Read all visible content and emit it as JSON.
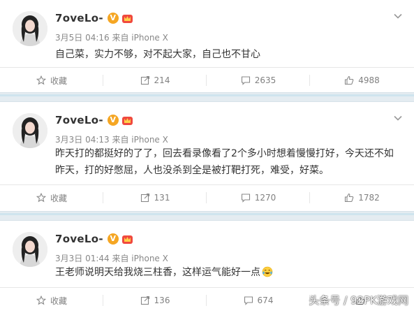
{
  "posts": [
    {
      "username": "7oveLo-",
      "meta": "3月5日 04:16 来自 iPhone X",
      "text": "自己菜，实力不够，对不起大家，自己也不甘心",
      "actions": {
        "favorite": "收藏",
        "repost": "214",
        "comment": "2635",
        "like": "4988"
      }
    },
    {
      "username": "7oveLo-",
      "meta": "3月3日 04:13 来自 iPhone X",
      "text": "昨天打的都挺好的了了，回去看录像看了2个多小时想着慢慢打好，今天还不如昨天，打的好憋屈，人也没杀到全是被打靶打死，难受，好菜。",
      "actions": {
        "favorite": "收藏",
        "repost": "131",
        "comment": "1270",
        "like": "1782"
      }
    },
    {
      "username": "7oveLo-",
      "meta": "3月3日 01:44 来自 iPhone X",
      "text": "王老师说明天给我烧三柱香，这样运气能好一点",
      "actions": {
        "favorite": "收藏",
        "repost": "136",
        "comment": "674",
        "like": ""
      }
    }
  ],
  "badges": {
    "verified": "V",
    "verified_color": "#f5a623",
    "vip_color": "#f0493e"
  },
  "icons": [
    "star-icon",
    "repost-icon",
    "comment-icon",
    "like-icon",
    "chevron-down-icon",
    "laugh-cry-emoji"
  ],
  "watermark": "头条号 / 92PK游戏网"
}
